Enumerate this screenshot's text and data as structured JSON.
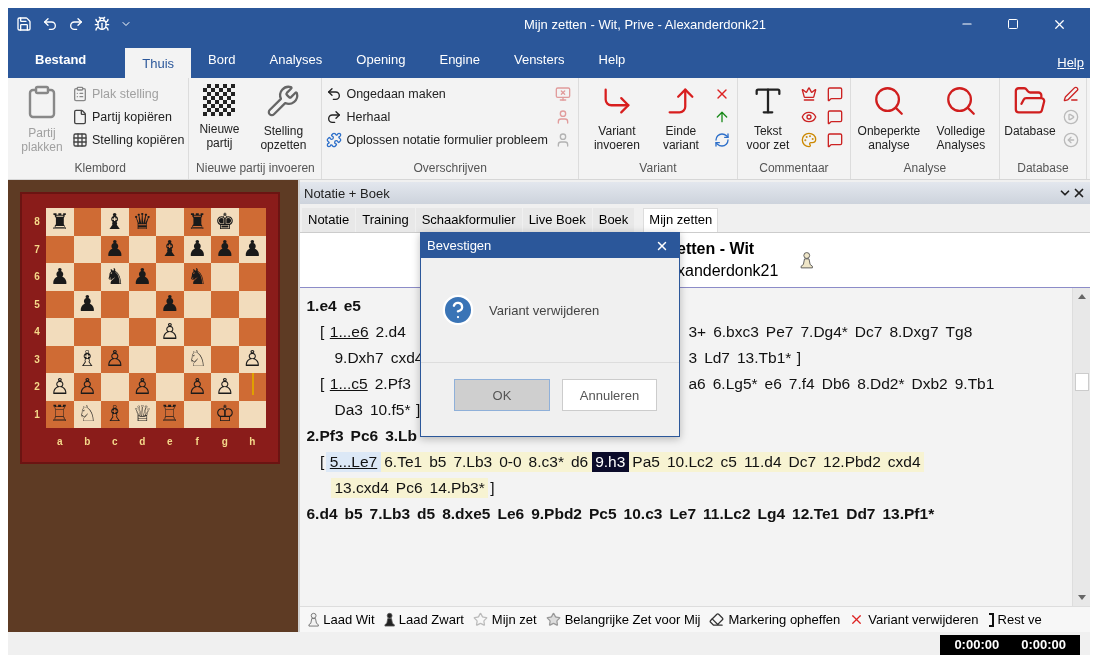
{
  "window": {
    "title": "Mijn zetten - Wit, Prive - Alexanderdonk21"
  },
  "menu": {
    "tabs": [
      {
        "label": "Bestand",
        "kind": "file",
        "selected": false
      },
      {
        "label": "Thuis",
        "kind": "tab",
        "selected": true
      },
      {
        "label": "Bord",
        "kind": "tab",
        "selected": false
      },
      {
        "label": "Analyses",
        "kind": "tab",
        "selected": false
      },
      {
        "label": "Opening",
        "kind": "tab",
        "selected": false
      },
      {
        "label": "Engine",
        "kind": "tab",
        "selected": false
      },
      {
        "label": "Vensters",
        "kind": "tab",
        "selected": false
      },
      {
        "label": "Help",
        "kind": "tab",
        "selected": false
      }
    ],
    "help": "Help"
  },
  "ribbon": {
    "groups": [
      {
        "label": "Klembord",
        "items": [
          {
            "kind": "large",
            "label": "Partij plakken",
            "disabled": true
          },
          {
            "kind": "small",
            "label": "Plak stelling",
            "disabled": true
          },
          {
            "kind": "small",
            "label": "Partij kopiëren",
            "disabled": false
          },
          {
            "kind": "small",
            "label": "Stelling kopiëren",
            "disabled": false
          }
        ]
      },
      {
        "label": "Nieuwe partij invoeren",
        "items": [
          {
            "kind": "large",
            "label": "Nieuwe partij",
            "disabled": false
          },
          {
            "kind": "large",
            "label": "Stelling opzetten",
            "disabled": false
          }
        ]
      },
      {
        "label": "Overschrijven",
        "items": [
          {
            "kind": "small",
            "label": "Ongedaan maken",
            "disabled": false
          },
          {
            "kind": "small",
            "label": "Herhaal",
            "disabled": false
          },
          {
            "kind": "small",
            "label": "Oplossen notatie formulier probleem",
            "disabled": false
          },
          {
            "kind": "icon",
            "disabled": true
          },
          {
            "kind": "icon",
            "disabled": true
          },
          {
            "kind": "icon",
            "disabled": true
          }
        ]
      },
      {
        "label": "Variant",
        "items": [
          {
            "kind": "large",
            "label": "Variant invoeren",
            "disabled": false
          },
          {
            "kind": "large",
            "label": "Einde variant",
            "disabled": false
          },
          {
            "kind": "icon",
            "disabled": false
          },
          {
            "kind": "icon",
            "disabled": false
          },
          {
            "kind": "icon",
            "disabled": false
          }
        ]
      },
      {
        "label": "Commentaar",
        "items": [
          {
            "kind": "large",
            "label": "Tekst voor zet",
            "disabled": false
          },
          {
            "kind": "icon",
            "disabled": false
          },
          {
            "kind": "icon",
            "disabled": false
          },
          {
            "kind": "icon",
            "disabled": false
          },
          {
            "kind": "icon",
            "disabled": false
          },
          {
            "kind": "icon",
            "disabled": false
          },
          {
            "kind": "icon",
            "disabled": false
          }
        ]
      },
      {
        "label": "Analyse",
        "items": [
          {
            "kind": "large",
            "label": "Onbeperkte analyse",
            "disabled": false
          },
          {
            "kind": "large",
            "label": "Volledige Analyses",
            "disabled": false
          }
        ]
      },
      {
        "label": "Database",
        "items": [
          {
            "kind": "large",
            "label": "Database",
            "disabled": false
          },
          {
            "kind": "icon",
            "disabled": false
          },
          {
            "kind": "icon",
            "disabled": true
          },
          {
            "kind": "icon",
            "disabled": true
          }
        ]
      }
    ]
  },
  "board": {
    "ranks": [
      "8",
      "7",
      "6",
      "5",
      "4",
      "3",
      "2",
      "1"
    ],
    "files": [
      "a",
      "b",
      "c",
      "d",
      "e",
      "f",
      "g",
      "h"
    ],
    "rows": [
      [
        "♜",
        null,
        "♝",
        "♛",
        null,
        "♜",
        "♚",
        null
      ],
      [
        null,
        null,
        "♟",
        null,
        "♝",
        "♟",
        "♟",
        "♟"
      ],
      [
        "♟",
        null,
        "♞",
        "♟",
        null,
        "♞",
        null,
        null
      ],
      [
        null,
        "♟",
        null,
        null,
        "♟",
        null,
        null,
        null
      ],
      [
        null,
        null,
        null,
        null,
        "♙",
        null,
        null,
        null
      ],
      [
        null,
        "♗",
        "♙",
        null,
        null,
        "♘",
        null,
        "♙"
      ],
      [
        "♙",
        "♙",
        null,
        "♙",
        null,
        "♙",
        "♙",
        null
      ],
      [
        "♖",
        "♘",
        "♗",
        "♕",
        "♖",
        null,
        "♔",
        null
      ]
    ]
  },
  "panel": {
    "title": "Notatie + Boek",
    "tabs": [
      {
        "label": "Notatie",
        "selected": false
      },
      {
        "label": "Training",
        "selected": false
      },
      {
        "label": "Schaakformulier",
        "selected": false
      },
      {
        "label": "Live Boek",
        "selected": false
      },
      {
        "label": "Boek",
        "selected": false
      },
      {
        "label": "Mijn zetten",
        "selected": true
      }
    ],
    "game_header": {
      "title": "etten - Wit",
      "subtitle": "xanderdonk21"
    },
    "notation": [
      {
        "kind": "main",
        "left": [
          {
            "text": "1.e4",
            "kind": "move"
          },
          {
            "text": "e5",
            "kind": "move"
          }
        ]
      },
      {
        "kind": "variation",
        "left": [
          {
            "text": "[",
            "kind": "bracket"
          },
          {
            "text": "1...e6",
            "kind": "link"
          },
          {
            "text": "2.d4",
            "kind": "move"
          }
        ],
        "right": [
          {
            "text": "3+",
            "kind": "move"
          },
          {
            "text": "6.bxc3",
            "kind": "move"
          },
          {
            "text": "Pe7",
            "kind": "move"
          },
          {
            "text": "7.Dg4*",
            "kind": "move"
          },
          {
            "text": "Dc7",
            "kind": "move"
          },
          {
            "text": "8.Dxg7",
            "kind": "move"
          },
          {
            "text": "Tg8",
            "kind": "move"
          }
        ]
      },
      {
        "kind": "continuation",
        "left": [
          {
            "text": "9.Dxh7",
            "kind": "move"
          },
          {
            "text": "cxd4",
            "kind": "move"
          }
        ],
        "right": [
          {
            "text": "3",
            "kind": "move"
          },
          {
            "text": "Ld7",
            "kind": "move"
          },
          {
            "text": "13.Tb1*",
            "kind": "move"
          },
          {
            "text": "]",
            "kind": "bracket"
          }
        ]
      },
      {
        "kind": "variation",
        "left": [
          {
            "text": "[",
            "kind": "bracket"
          },
          {
            "text": "1...c5",
            "kind": "link"
          },
          {
            "text": "2.Pf3",
            "kind": "move"
          }
        ],
        "right": [
          {
            "text": "a6",
            "kind": "move"
          },
          {
            "text": "6.Lg5*",
            "kind": "move"
          },
          {
            "text": "e6",
            "kind": "move"
          },
          {
            "text": "7.f4",
            "kind": "move"
          },
          {
            "text": "Db6",
            "kind": "move"
          },
          {
            "text": "8.Dd2*",
            "kind": "move"
          },
          {
            "text": "Dxb2",
            "kind": "move"
          },
          {
            "text": "9.Tb1",
            "kind": "move"
          }
        ]
      },
      {
        "kind": "continuation",
        "left": [
          {
            "text": "Da3",
            "kind": "move"
          },
          {
            "text": "10.f5*",
            "kind": "move"
          },
          {
            "text": "]",
            "kind": "bracket"
          }
        ]
      },
      {
        "kind": "main",
        "left": [
          {
            "text": "2.Pf3",
            "kind": "move"
          },
          {
            "text": "Pc6",
            "kind": "move"
          },
          {
            "text": "3.Lb",
            "kind": "move"
          }
        ]
      },
      {
        "kind": "variation",
        "left": [
          {
            "text": "[",
            "kind": "bracket"
          },
          {
            "text": "5...Le7",
            "kind": "selected-link"
          },
          {
            "text": "6.Te1",
            "kind": "highlight"
          },
          {
            "text": "b5",
            "kind": "highlight"
          },
          {
            "text": "7.Lb3",
            "kind": "highlight"
          },
          {
            "text": "0-0",
            "kind": "highlight"
          },
          {
            "text": "8.c3*",
            "kind": "highlight"
          },
          {
            "text": "d6",
            "kind": "highlight"
          },
          {
            "text": "9.h3",
            "kind": "current"
          },
          {
            "text": "Pa5",
            "kind": "highlight"
          },
          {
            "text": "10.Lc2",
            "kind": "highlight"
          },
          {
            "text": "c5",
            "kind": "highlight"
          },
          {
            "text": "11.d4",
            "kind": "highlight"
          },
          {
            "text": "Dc7",
            "kind": "highlight"
          },
          {
            "text": "12.Pbd2",
            "kind": "highlight"
          },
          {
            "text": "cxd4",
            "kind": "highlight"
          }
        ]
      },
      {
        "kind": "continuation",
        "left": [
          {
            "text": "13.cxd4",
            "kind": "highlight"
          },
          {
            "text": "Pc6",
            "kind": "highlight"
          },
          {
            "text": "14.Pb3*",
            "kind": "highlight"
          },
          {
            "text": "]",
            "kind": "bracket"
          }
        ]
      },
      {
        "kind": "main",
        "left": [
          {
            "text": "6.d4",
            "kind": "move"
          },
          {
            "text": "b5",
            "kind": "move"
          },
          {
            "text": "7.Lb3",
            "kind": "move"
          },
          {
            "text": "d5",
            "kind": "move"
          },
          {
            "text": "8.dxe5",
            "kind": "move"
          },
          {
            "text": "Le6",
            "kind": "move"
          },
          {
            "text": "9.Pbd2",
            "kind": "move"
          },
          {
            "text": "Pc5",
            "kind": "move"
          },
          {
            "text": "10.c3",
            "kind": "move"
          },
          {
            "text": "Le7",
            "kind": "move"
          },
          {
            "text": "11.Lc2",
            "kind": "move"
          },
          {
            "text": "Lg4",
            "kind": "move"
          },
          {
            "text": "12.Te1",
            "kind": "move"
          },
          {
            "text": "Dd7",
            "kind": "move"
          },
          {
            "text": "13.Pf1*",
            "kind": "move"
          }
        ]
      }
    ],
    "toolbar": [
      {
        "label": "Laad Wit"
      },
      {
        "label": "Laad Zwart"
      },
      {
        "label": "Mijn zet"
      },
      {
        "label": "Belangrijke Zet voor Mij"
      },
      {
        "label": "Markering opheffen"
      },
      {
        "label": "Variant verwijderen"
      },
      {
        "label": "Rest ve"
      }
    ]
  },
  "dialog": {
    "title": "Bevestigen",
    "message": "Variant verwijderen",
    "buttons": [
      {
        "label": "OK",
        "selected": true
      },
      {
        "label": "Annuleren",
        "selected": false
      }
    ]
  },
  "status_bar": {
    "clocks": [
      "0:00:00",
      "0:00:00"
    ]
  }
}
